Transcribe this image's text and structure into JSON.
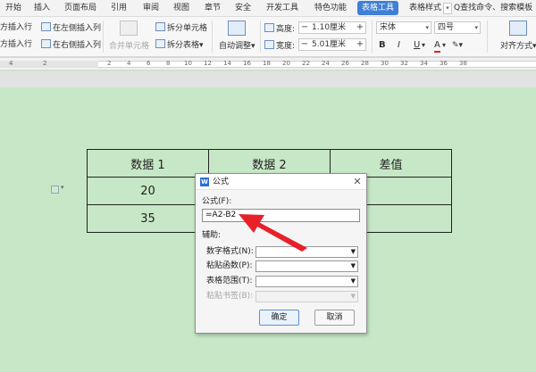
{
  "menu": {
    "tabs": [
      "开始",
      "插入",
      "页面布局",
      "引用",
      "审阅",
      "视图",
      "章节",
      "安全",
      "开发工具",
      "特色功能",
      "表格工具",
      "表格样式"
    ],
    "active": "表格工具",
    "search": "Q查找命令、搜索模板"
  },
  "ribbon": {
    "insert_above": "方插入行",
    "insert_below": "方插入行",
    "insert_left": "在左侧插入列",
    "insert_right": "在右侧插入列",
    "merge_cells": "合并单元格",
    "split_cells": "拆分单元格",
    "split_table": "拆分表格",
    "auto_fit": "自动调整",
    "height_label": "高度:",
    "height_value": "1.10厘米",
    "width_label": "宽度:",
    "width_value": "5.01厘米",
    "font_name": "宋体",
    "font_size": "四号",
    "bold": "B",
    "italic": "I",
    "underline": "U",
    "font_color": "A",
    "align": "对齐方式"
  },
  "ruler": {
    "numbers": [
      "4",
      "2",
      "2",
      "4",
      "6",
      "8",
      "10",
      "12",
      "14",
      "16",
      "18",
      "20",
      "22",
      "24",
      "26",
      "28",
      "30",
      "32",
      "34",
      "36",
      "38"
    ]
  },
  "table": {
    "rows": [
      [
        "数据 1",
        "数据 2",
        "差值"
      ],
      [
        "20",
        "",
        ""
      ],
      [
        "35",
        "",
        ""
      ]
    ]
  },
  "dialog": {
    "logo": "W",
    "title": "公式",
    "formula_label": "公式(F):",
    "formula_value": "=A2-B2",
    "assist_label": "辅助:",
    "number_format_label": "数字格式(N):",
    "paste_function_label": "粘贴函数(P):",
    "table_range_label": "表格范围(T):",
    "paste_bookmark_label": "粘贴书签(B):",
    "ok": "确定",
    "cancel": "取消"
  },
  "colors": {
    "page_bg": "#c7e8c6",
    "accent": "#3f7fd6",
    "arrow": "#e8202a"
  },
  "icons": [
    "close-icon",
    "dropdown-arrow-icon",
    "w-logo-icon",
    "table-handle-icon"
  ]
}
